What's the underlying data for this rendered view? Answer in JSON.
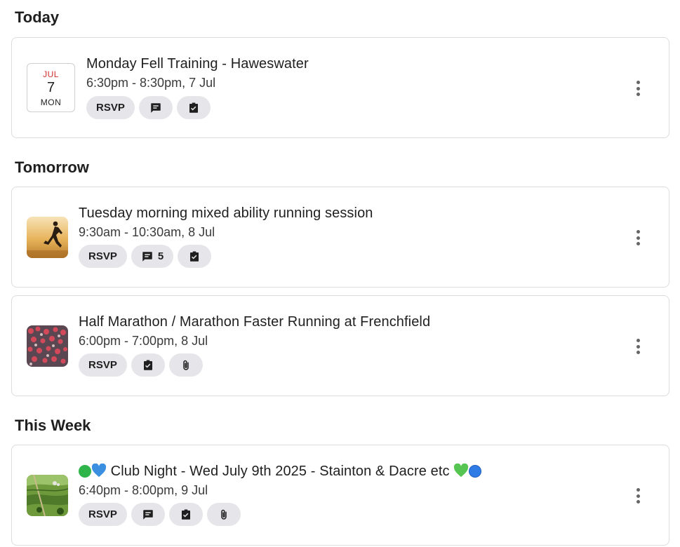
{
  "sections": {
    "today": "Today",
    "tomorrow": "Tomorrow",
    "this_week": "This Week"
  },
  "events": [
    {
      "title": "Monday Fell Training - Haweswater",
      "time": "6:30pm - 8:30pm, 7 Jul",
      "calendar": {
        "month": "JUL",
        "day": "7",
        "weekday": "MON"
      },
      "rsvp": "RSVP",
      "icons": [
        "comment-icon",
        "task-check-icon"
      ]
    },
    {
      "title": "Tuesday morning mixed ability running session",
      "time": "9:30am - 10:30am, 8 Jul",
      "thumbnail": "runner-silhouette-image",
      "rsvp": "RSVP",
      "comment_count": "5",
      "icons": [
        "comment-icon",
        "task-check-icon"
      ]
    },
    {
      "title": "Half Marathon / Marathon Faster Running at Frenchfield",
      "time": "6:00pm - 7:00pm, 8 Jul",
      "thumbnail": "race-crowd-image",
      "rsvp": "RSVP",
      "icons": [
        "task-check-icon",
        "paperclip-icon"
      ]
    },
    {
      "title": "Club Night - Wed July 9th 2025 - Stainton & Dacre etc",
      "time": "6:40pm - 8:00pm, 9 Jul",
      "thumbnail": "countryside-aerial-image",
      "title_emoji": [
        "green-circle",
        "blue-heart",
        "green-heart",
        "blue-circle"
      ],
      "rsvp": "RSVP",
      "icons": [
        "comment-icon",
        "task-check-icon",
        "paperclip-icon"
      ]
    }
  ],
  "colors": {
    "calendar_month": "#d32f2f",
    "chip_bg": "#e6e6ea",
    "card_border": "#dcdcdc"
  }
}
